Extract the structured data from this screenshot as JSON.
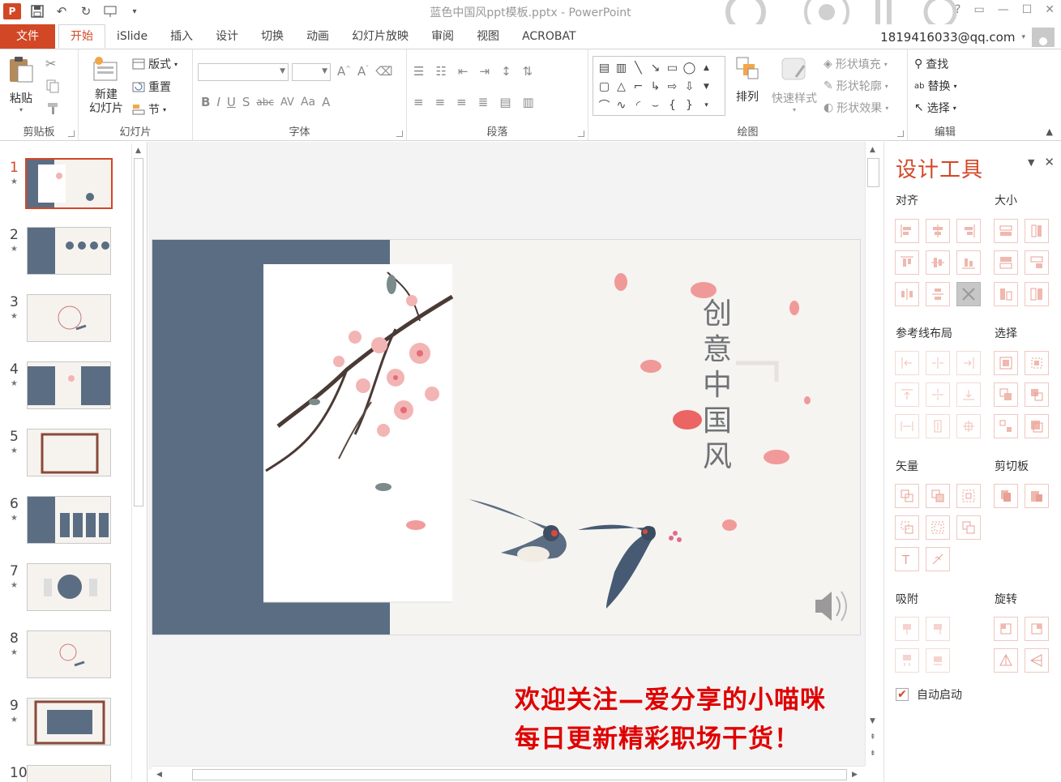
{
  "titlebar": {
    "app_icon": "P",
    "document_title": "蓝色中国风ppt模板.pptx - PowerPoint",
    "window_controls": [
      "?",
      "▭",
      "—",
      "☐",
      "✕"
    ]
  },
  "menu": {
    "file": "文件",
    "tabs": [
      "开始",
      "iSlide",
      "插入",
      "设计",
      "切换",
      "动画",
      "幻灯片放映",
      "审阅",
      "视图",
      "ACROBAT"
    ],
    "active_tab": "开始",
    "account": "1819416033@qq.com"
  },
  "ribbon": {
    "clipboard": {
      "paste": "粘贴",
      "label": "剪贴板"
    },
    "slides": {
      "new_slide_line1": "新建",
      "new_slide_line2": "幻灯片",
      "layout": "版式",
      "reset": "重置",
      "section": "节",
      "label": "幻灯片"
    },
    "font": {
      "label": "字体",
      "buttons": [
        "B",
        "I",
        "U",
        "S",
        "abc",
        "AV",
        "Aa",
        "A"
      ]
    },
    "paragraph": {
      "label": "段落"
    },
    "drawing": {
      "arrange": "排列",
      "quick_styles": "快速样式",
      "shape_fill": "形状填充",
      "shape_outline": "形状轮廓",
      "shape_effects": "形状效果",
      "label": "绘图"
    },
    "editing": {
      "find": "查找",
      "replace": "替换",
      "select": "选择",
      "label": "编辑"
    }
  },
  "thumbnails": {
    "selected": 1,
    "items": [
      {
        "num": "1"
      },
      {
        "num": "2"
      },
      {
        "num": "3"
      },
      {
        "num": "4"
      },
      {
        "num": "5"
      },
      {
        "num": "6"
      },
      {
        "num": "7"
      },
      {
        "num": "8"
      },
      {
        "num": "9"
      },
      {
        "num": "10"
      }
    ]
  },
  "slide": {
    "title_chars": [
      "创",
      "意",
      "中",
      "国",
      "风"
    ],
    "accent_color": "#5b6d82",
    "petal_color": "#f08a8a"
  },
  "banner": {
    "line1": "欢迎关注—爱分享的小喵咪",
    "line2": "每日更新精彩职场干货！",
    "color": "#e00000"
  },
  "design_pane": {
    "title": "设计工具",
    "sections": {
      "align": "对齐",
      "size": "大小",
      "guides": "参考线布局",
      "select": "选择",
      "vector": "矢量",
      "clipboard": "剪切板",
      "snap": "吸附",
      "rotate": "旋转"
    },
    "autostart_label": "自动启动",
    "autostart_checked": true
  },
  "colors": {
    "brand": "#d24726",
    "banner": "#e00000"
  }
}
